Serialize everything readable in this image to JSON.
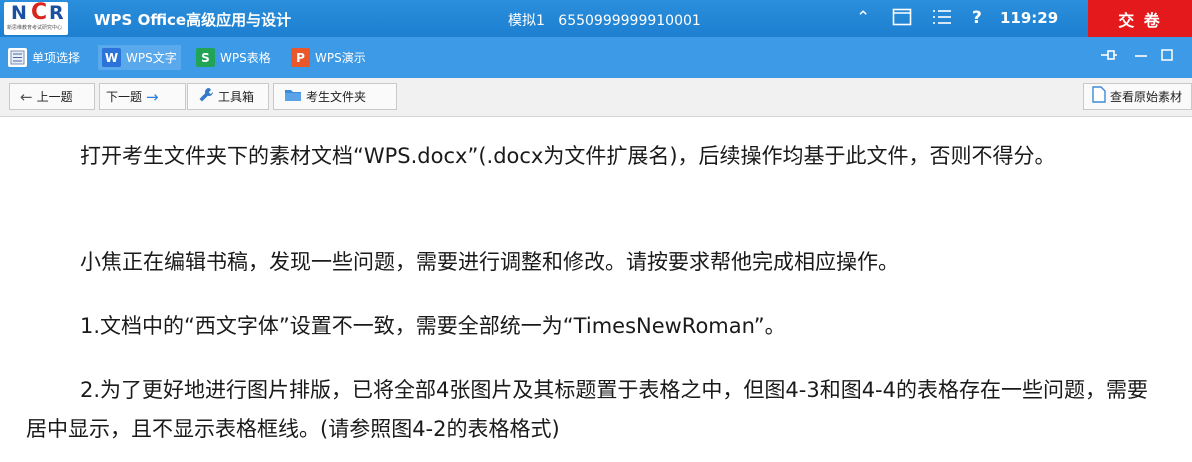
{
  "titlebar": {
    "logo_text": "NCR",
    "logo_subtext": "新思维教育考试研究中心",
    "app_title": "WPS Office高级应用与设计",
    "exam_label": "模拟1",
    "exam_id": "6550999999910001",
    "help": "?",
    "timer": "119:29",
    "submit_label": "交 卷"
  },
  "tabs": [
    {
      "label": "单项选择",
      "icon": "list-icon"
    },
    {
      "label": "WPS文字",
      "icon": "W",
      "color": "#2b73d8"
    },
    {
      "label": "WPS表格",
      "icon": "S",
      "color": "#22a457"
    },
    {
      "label": "WPS演示",
      "icon": "P",
      "color": "#e9572b"
    }
  ],
  "toolbar": {
    "prev": "上一题",
    "next": "下一题",
    "tools": "工具箱",
    "folder": "考生文件夹",
    "view_source": "查看原始素材"
  },
  "content": {
    "p1": "打开考生文件夹下的素材文档“WPS.docx”(.docx为文件扩展名)，后续操作均基于此文件，否则不得分。",
    "p2": "小焦正在编辑书稿，发现一些问题，需要进行调整和修改。请按要求帮他完成相应操作。",
    "p3": "1.文档中的“西文字体”设置不一致，需要全部统一为“TimesNewRoman”。",
    "p4": "2.为了更好地进行图片排版，已将全部4张图片及其标题置于表格之中，但图4-3和图4-4的表格存在一些问题，需要居中显示，且不显示表格框线。(请参照图4-2的表格格式)"
  },
  "colors": {
    "titlebar": "#1e7fd0",
    "tabbar": "#3d9ae6",
    "submit": "#e3191c"
  }
}
